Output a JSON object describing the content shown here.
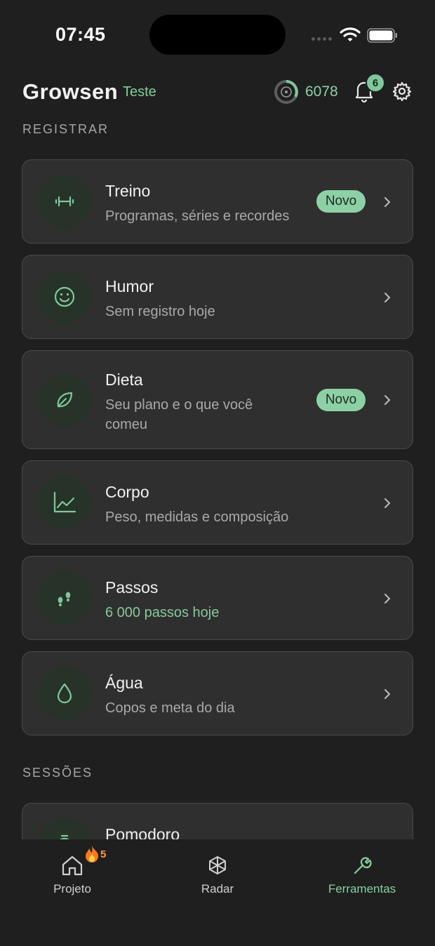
{
  "status": {
    "time": "07:45"
  },
  "header": {
    "brand": "Growsen",
    "tag": "Teste",
    "points": "6078",
    "notifications": "6"
  },
  "sections": {
    "register": "REGISTRAR",
    "sessions": "SESSÕES"
  },
  "cards": [
    {
      "title": "Treino",
      "subtitle": "Programas, séries e recordes",
      "badge": "Novo",
      "icon": "dumbbell-icon"
    },
    {
      "title": "Humor",
      "subtitle": "Sem registro hoje",
      "icon": "smile-icon"
    },
    {
      "title": "Dieta",
      "subtitle_line1": "Seu plano e o que você",
      "subtitle_line2": "comeu",
      "badge": "Novo",
      "icon": "leaf-icon"
    },
    {
      "title": "Corpo",
      "subtitle": "Peso, medidas e composição",
      "icon": "chart-icon"
    },
    {
      "title": "Passos",
      "subtitle": "6 000 passos hoje",
      "icon": "footsteps-icon"
    },
    {
      "title": "Água",
      "subtitle": "Copos e meta do dia",
      "icon": "droplet-icon"
    },
    {
      "title": "Pomodoro",
      "icon": "timer-icon"
    }
  ],
  "nav": {
    "items": [
      {
        "label": "Projeto",
        "icon": "home-icon"
      },
      {
        "label": "Radar",
        "icon": "radar-icon"
      },
      {
        "label": "Ferramentas",
        "icon": "wrench-icon"
      }
    ],
    "streak": "5",
    "active": "Ferramentas"
  },
  "colors": {
    "accent": "#86cf9f",
    "background": "#1f1f1f",
    "card": "#2f2f2f",
    "badge": "#8ed0a6"
  }
}
